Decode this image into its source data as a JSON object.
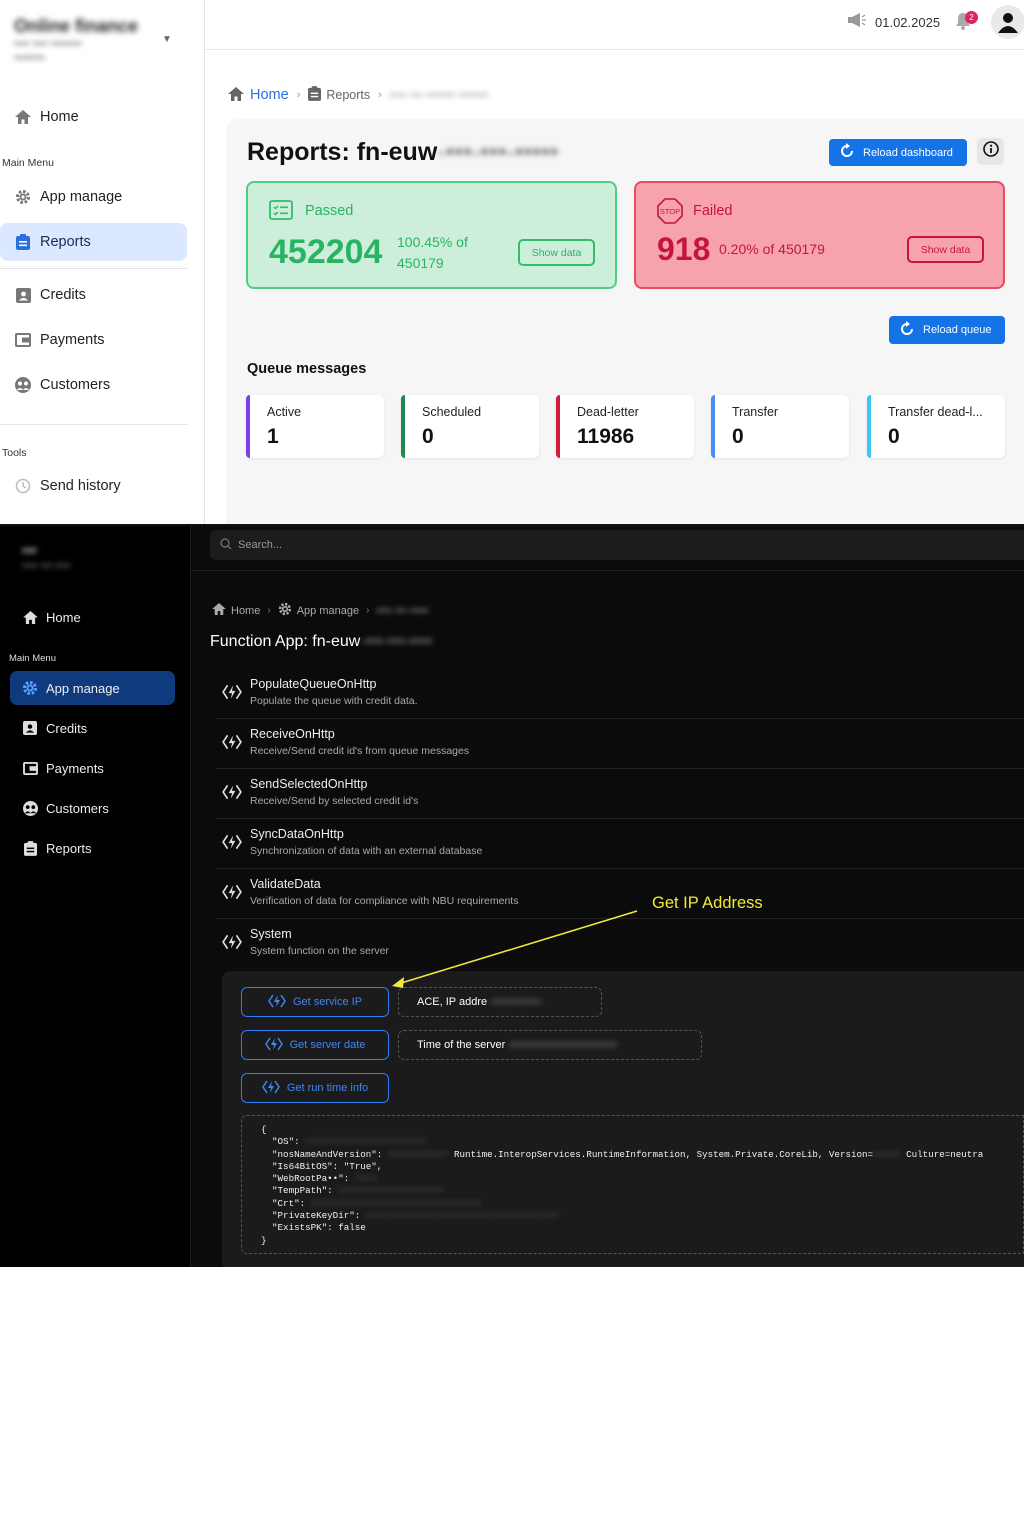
{
  "light": {
    "brand": {
      "name": "Online finance",
      "sub1": "•••• •••• ••••••••",
      "sub2": "••••••••"
    },
    "menu": {
      "home": "Home",
      "main_section": "Main Menu",
      "items": [
        "App manage",
        "Reports",
        "Credits",
        "Payments",
        "Customers"
      ],
      "tools_section": "Tools",
      "send_history": "Send history"
    },
    "topbar": {
      "date": "01.02.2025",
      "notif_count": "2"
    },
    "breadcrumb": {
      "home": "Home",
      "reports": "Reports",
      "current": "•••• ••• ••••••• •••••••"
    },
    "title": {
      "prefix": "Reports: fn-euw",
      "redacted": "-•••-•••-•••••"
    },
    "reload_dashboard": "Reload dashboard",
    "passed": {
      "label": "Passed",
      "count": "452204",
      "pct_line1": "100.45% of",
      "pct_line2": "450179",
      "button": "Show data"
    },
    "failed": {
      "label": "Failed",
      "count": "918",
      "pct": "0.20% of 450179",
      "button": "Show data",
      "icon_text": "STOP"
    },
    "reload_queue": "Reload queue",
    "queue": {
      "title": "Queue messages",
      "cards": [
        {
          "label": "Active",
          "value": "1",
          "color": "#7b3fe4"
        },
        {
          "label": "Scheduled",
          "value": "0",
          "color": "#1e8b4c"
        },
        {
          "label": "Dead-letter",
          "value": "11986",
          "color": "#d11c3a"
        },
        {
          "label": "Transfer",
          "value": "0",
          "color": "#4a8cf0"
        },
        {
          "label": "Transfer dead-l...",
          "value": "0",
          "color": "#38c8f2"
        }
      ]
    }
  },
  "dark": {
    "brand": {
      "name": "•••",
      "sub": "•••• ••• ••••"
    },
    "search_placeholder": "Search...",
    "menu": {
      "home": "Home",
      "main_section": "Main Menu",
      "items": [
        "App manage",
        "Credits",
        "Payments",
        "Customers",
        "Reports"
      ]
    },
    "breadcrumb": {
      "home": "Home",
      "app_manage": "App manage",
      "current": "•••• ••• •••••"
    },
    "title": {
      "prefix": "Function App: fn-euw",
      "redacted": "-•••-•••-••••"
    },
    "functions": [
      {
        "name": "PopulateQueueOnHttp",
        "desc": "Populate the queue with credit data."
      },
      {
        "name": "ReceiveOnHttp",
        "desc": "Receive/Send credit id's from queue messages"
      },
      {
        "name": "SendSelectedOnHttp",
        "desc": "Receive/Send by selected credit id's"
      },
      {
        "name": "SyncDataOnHttp",
        "desc": "Synchronization of data with an external database"
      },
      {
        "name": "ValidateData",
        "desc": "Verification of data for compliance with NBU requirements"
      },
      {
        "name": "System",
        "desc": "System function on the server"
      }
    ],
    "system": {
      "buttons": [
        "Get service IP",
        "Get server date",
        "Get run time info"
      ],
      "ip_label": "ACE, IP addre",
      "ip_value": "•••••••••••••",
      "time_label": "Time of the server",
      "time_value": "••••••••••••••••••••••••••••",
      "code": {
        "open": "{",
        "os_key": "\"OS\":",
        "nos_key": "\"nosNameAndVersion\":",
        "nos_val": "Runtime.InteropServices.RuntimeInformation, System.Private.CoreLib, Version=",
        "nos_tail": "Culture=neutra",
        "is64": "\"Is64BitOS\": \"True\",",
        "webroot": "\"WebRootPa••\":",
        "temppath": "\"TempPath\":",
        "crt": "\"Crt\":",
        "privkey": "\"PrivateKeyDir\":",
        "existspk": "\"ExistsPK\": false",
        "close": "}"
      }
    },
    "annotation": "Get IP Address"
  }
}
